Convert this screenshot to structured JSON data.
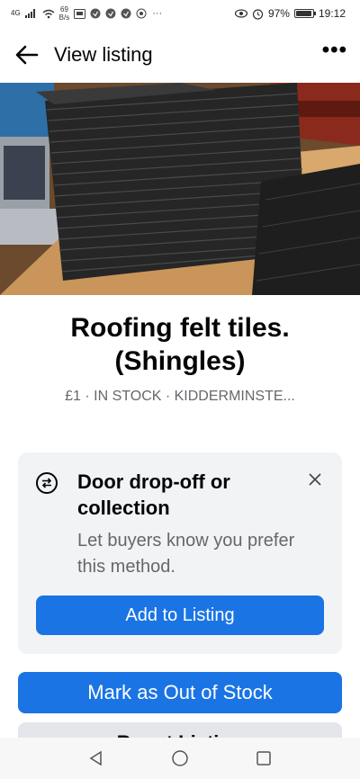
{
  "status_bar": {
    "network": "4G",
    "speed_value": "69",
    "speed_unit": "B/s",
    "more": "···",
    "battery_text": "97%",
    "battery_level": 0.97,
    "time": "19:12"
  },
  "header": {
    "title": "View listing",
    "more_label": "•••"
  },
  "listing": {
    "title": "Roofing felt tiles. (Shingles)",
    "meta": "£1 · IN STOCK · KIDDERMINSTE..."
  },
  "card": {
    "title": "Door drop-off or collection",
    "description": "Let buyers know you prefer this method.",
    "button": "Add to Listing"
  },
  "actions": {
    "mark_out_of_stock": "Mark as Out of Stock",
    "boost": "Boost Listing"
  },
  "colors": {
    "accent": "#1b74e4",
    "secondary_text": "#65676b",
    "card_bg": "#f2f3f5"
  }
}
